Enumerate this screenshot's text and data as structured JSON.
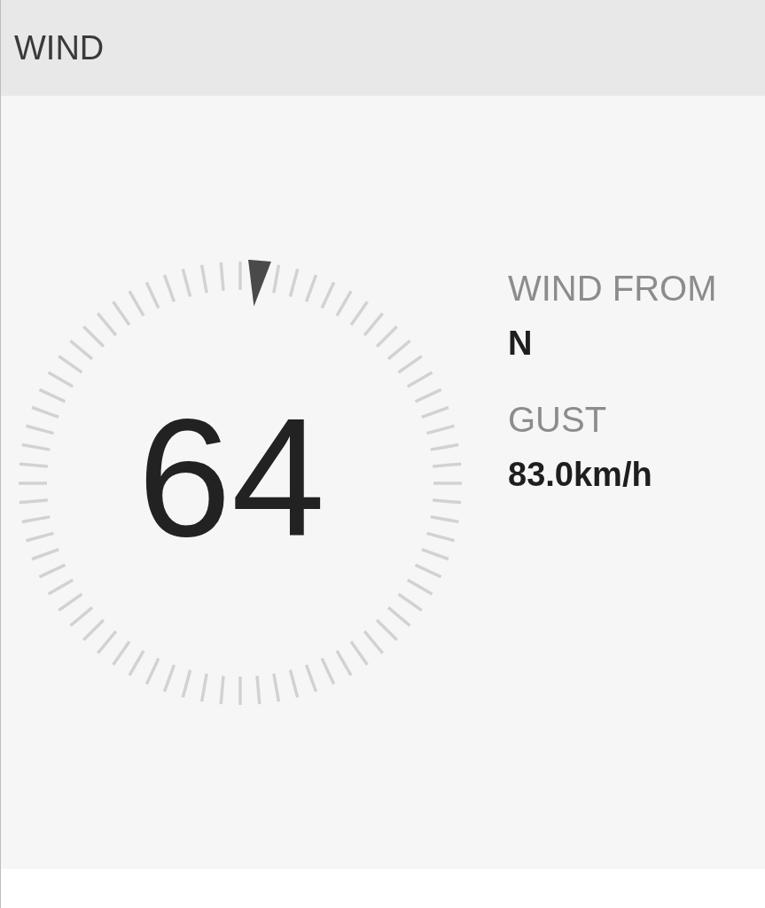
{
  "header": {
    "title": "WIND"
  },
  "dial": {
    "speed": "64"
  },
  "details": [
    {
      "label": "WIND FROM",
      "value": "N"
    },
    {
      "label": "GUST",
      "value": "83.0km/h"
    }
  ]
}
